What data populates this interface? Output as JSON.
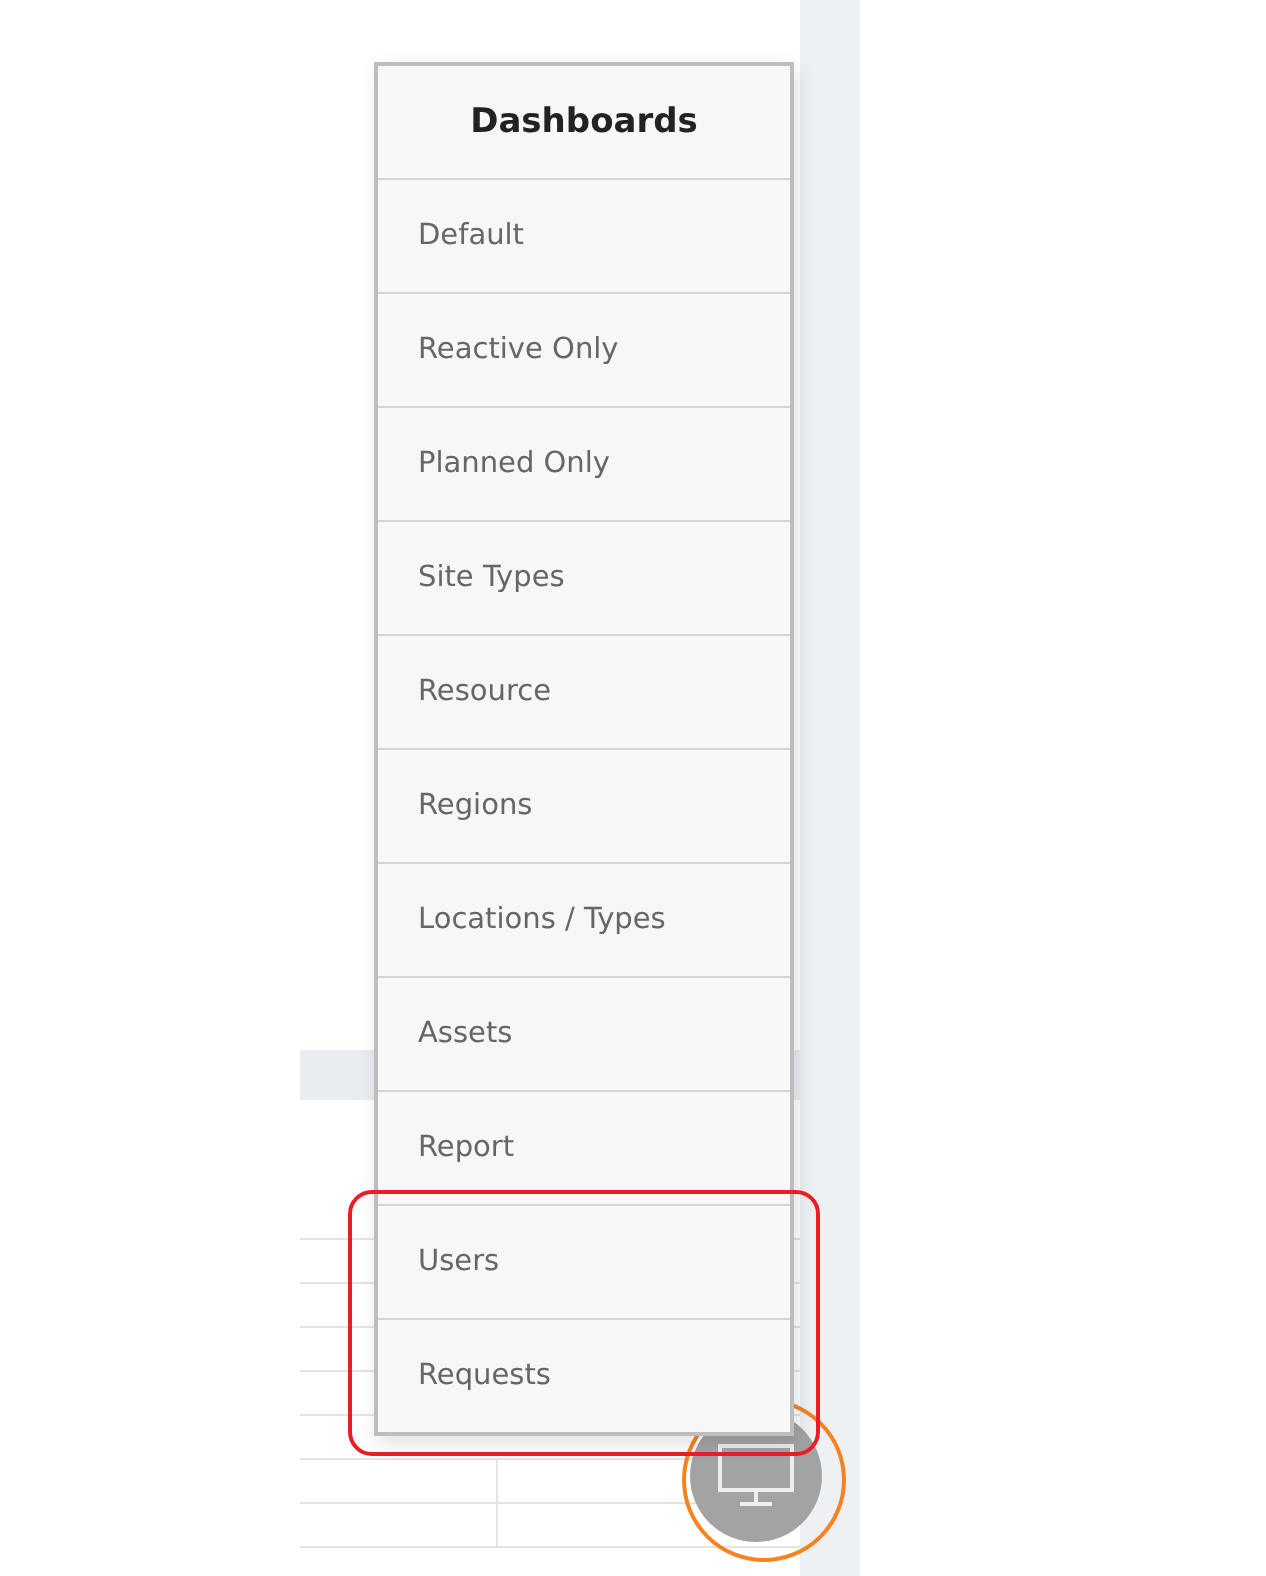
{
  "menu": {
    "title": "Dashboards",
    "items": [
      {
        "label": "Default"
      },
      {
        "label": "Reactive Only"
      },
      {
        "label": "Planned Only"
      },
      {
        "label": "Site Types"
      },
      {
        "label": "Resource"
      },
      {
        "label": "Regions"
      },
      {
        "label": "Locations / Types"
      },
      {
        "label": "Assets"
      },
      {
        "label": "Report"
      }
    ],
    "highlighted_items": [
      {
        "label": "Users"
      },
      {
        "label": "Requests"
      }
    ]
  },
  "dashboard_button": {
    "circled": true
  }
}
